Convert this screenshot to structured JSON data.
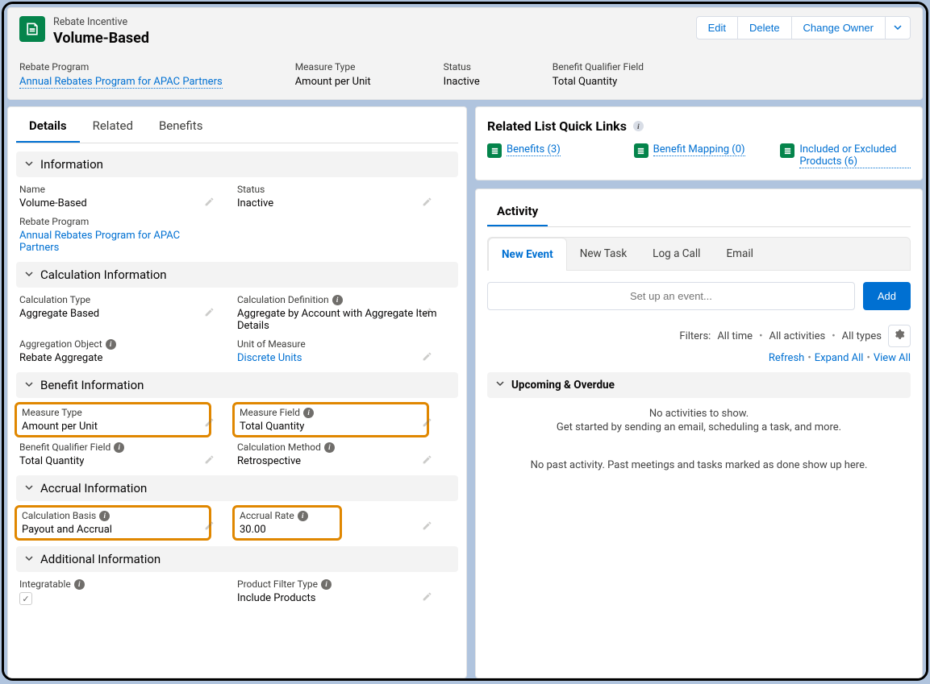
{
  "header": {
    "objectLabel": "Rebate Incentive",
    "recordName": "Volume-Based",
    "actions": {
      "edit": "Edit",
      "delete": "Delete",
      "changeOwner": "Change Owner"
    },
    "fields": {
      "rebateProgram": {
        "label": "Rebate Program",
        "value": "Annual Rebates Program for APAC Partners"
      },
      "measureType": {
        "label": "Measure Type",
        "value": "Amount per Unit"
      },
      "status": {
        "label": "Status",
        "value": "Inactive"
      },
      "benefitQualifier": {
        "label": "Benefit Qualifier Field",
        "value": "Total Quantity"
      }
    }
  },
  "tabs": {
    "details": "Details",
    "related": "Related",
    "benefits": "Benefits"
  },
  "sections": {
    "information": {
      "title": "Information",
      "name": {
        "label": "Name",
        "value": "Volume-Based"
      },
      "status": {
        "label": "Status",
        "value": "Inactive"
      },
      "rebateProgram": {
        "label": "Rebate Program",
        "value": "Annual Rebates Program for APAC Partners"
      }
    },
    "calc": {
      "title": "Calculation Information",
      "calcType": {
        "label": "Calculation Type",
        "value": "Aggregate Based"
      },
      "calcDef": {
        "label": "Calculation Definition",
        "value": "Aggregate by Account with Aggregate Item Details"
      },
      "aggObj": {
        "label": "Aggregation Object",
        "value": "Rebate Aggregate"
      },
      "uom": {
        "label": "Unit of Measure",
        "value": "Discrete Units"
      }
    },
    "benefit": {
      "title": "Benefit Information",
      "measureType": {
        "label": "Measure Type",
        "value": "Amount per Unit"
      },
      "measureField": {
        "label": "Measure Field",
        "value": "Total Quantity"
      },
      "benefitQual": {
        "label": "Benefit Qualifier Field",
        "value": "Total Quantity"
      },
      "calcMethod": {
        "label": "Calculation Method",
        "value": "Retrospective"
      }
    },
    "accrual": {
      "title": "Accrual Information",
      "calcBasis": {
        "label": "Calculation Basis",
        "value": "Payout and Accrual"
      },
      "accrualRate": {
        "label": "Accrual Rate",
        "value": "30.00"
      }
    },
    "additional": {
      "title": "Additional Information",
      "integratable": {
        "label": "Integratable"
      },
      "productFilter": {
        "label": "Product Filter Type",
        "value": "Include Products"
      }
    }
  },
  "quickLinks": {
    "title": "Related List Quick Links",
    "items": {
      "benefits": "Benefits (3)",
      "mapping": "Benefit Mapping (0)",
      "products": "Included or Excluded Products (6)"
    }
  },
  "activity": {
    "title": "Activity",
    "subtabs": {
      "newEvent": "New Event",
      "newTask": "New Task",
      "logCall": "Log a Call",
      "email": "Email"
    },
    "eventPlaceholder": "Set up an event...",
    "addBtn": "Add",
    "filters": {
      "prefix": "Filters:",
      "time": "All time",
      "activities": "All activities",
      "types": "All types"
    },
    "links": {
      "refresh": "Refresh",
      "expand": "Expand All",
      "viewAll": "View All"
    },
    "upcoming": "Upcoming & Overdue",
    "emptyTitle": "No activities to show.",
    "emptySub": "Get started by sending an email, scheduling a task, and more.",
    "pastMsg": "No past activity. Past meetings and tasks marked as done show up here."
  }
}
